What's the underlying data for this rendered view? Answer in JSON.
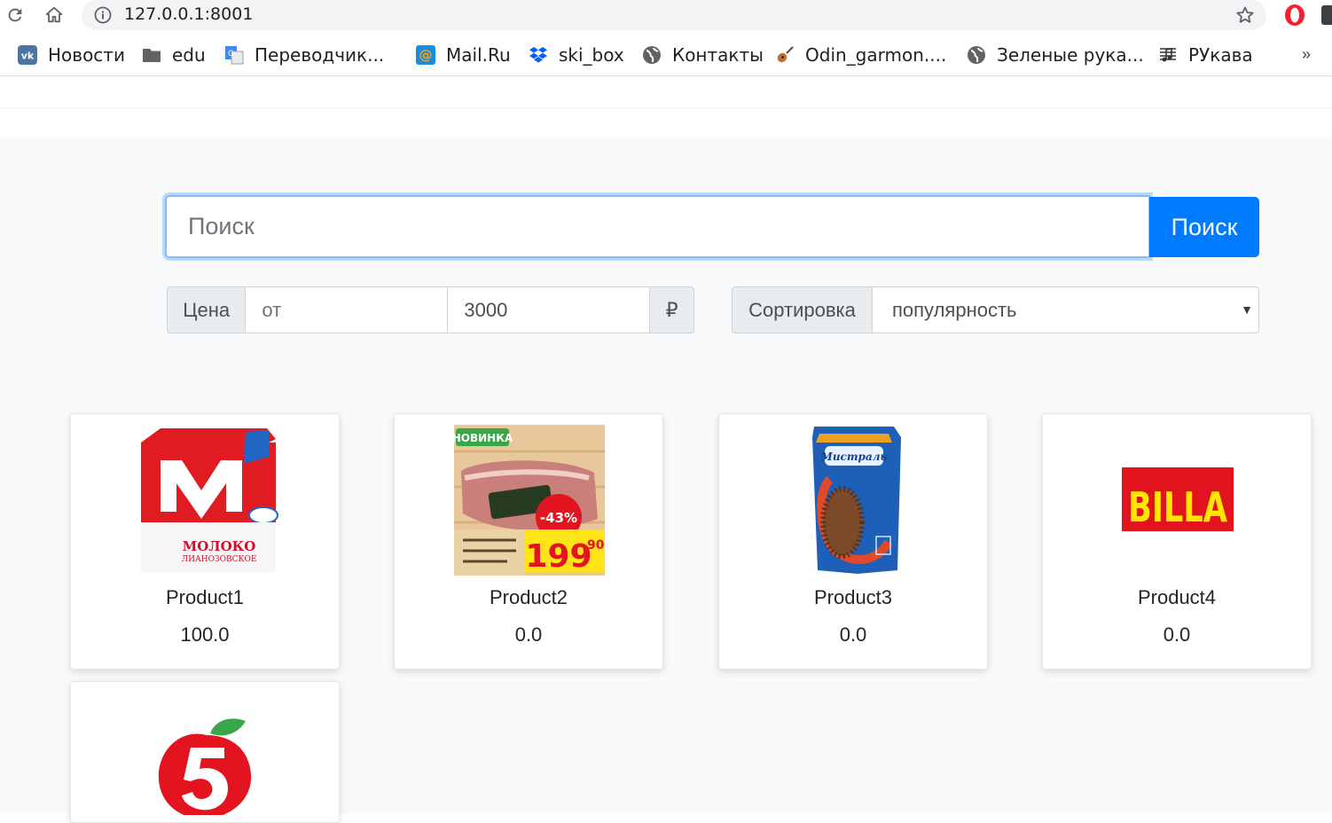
{
  "browser": {
    "url": "127.0.0.1:8001",
    "bookmarks": [
      {
        "label": "Новости",
        "icon": "vk-icon"
      },
      {
        "label": "edu",
        "icon": "folder-icon"
      },
      {
        "label": "Переводчик...",
        "icon": "translate-icon"
      },
      {
        "label": "Mail.Ru",
        "icon": "mailru-icon"
      },
      {
        "label": "ski_box",
        "icon": "dropbox-icon"
      },
      {
        "label": "Контакты",
        "icon": "globe-icon"
      },
      {
        "label": "Odin_garmon....",
        "icon": "guitar-icon"
      },
      {
        "label": "Зеленые рука...",
        "icon": "globe-icon"
      },
      {
        "label": "РУкава",
        "icon": "music-icon"
      }
    ],
    "more": "»"
  },
  "search": {
    "placeholder": "Поиск",
    "button": "Поиск"
  },
  "filters": {
    "price_label": "Цена",
    "from_placeholder": "от",
    "to_value": "3000",
    "currency": "₽",
    "sort_label": "Сортировка",
    "sort_value": "популярность"
  },
  "products": [
    {
      "name": "Product1",
      "price": "100.0",
      "image": "milk-carton"
    },
    {
      "name": "Product2",
      "price": "0.0",
      "image": "brisket-ad",
      "ad_badge": "НОВИНКА",
      "ad_discount": "-43%",
      "ad_price": "199",
      "ad_cents": "90"
    },
    {
      "name": "Product3",
      "price": "0.0",
      "image": "buckwheat-pack"
    },
    {
      "name": "Product4",
      "price": "0.0",
      "image": "billa-logo",
      "logo_text": "BILLA"
    },
    {
      "name": "",
      "price": "",
      "image": "pyaterochka-logo"
    }
  ],
  "colors": {
    "primary": "#007bff",
    "page_bg": "#f8f9fa",
    "billa_red": "#e1141e",
    "billa_yellow": "#ffe600"
  }
}
